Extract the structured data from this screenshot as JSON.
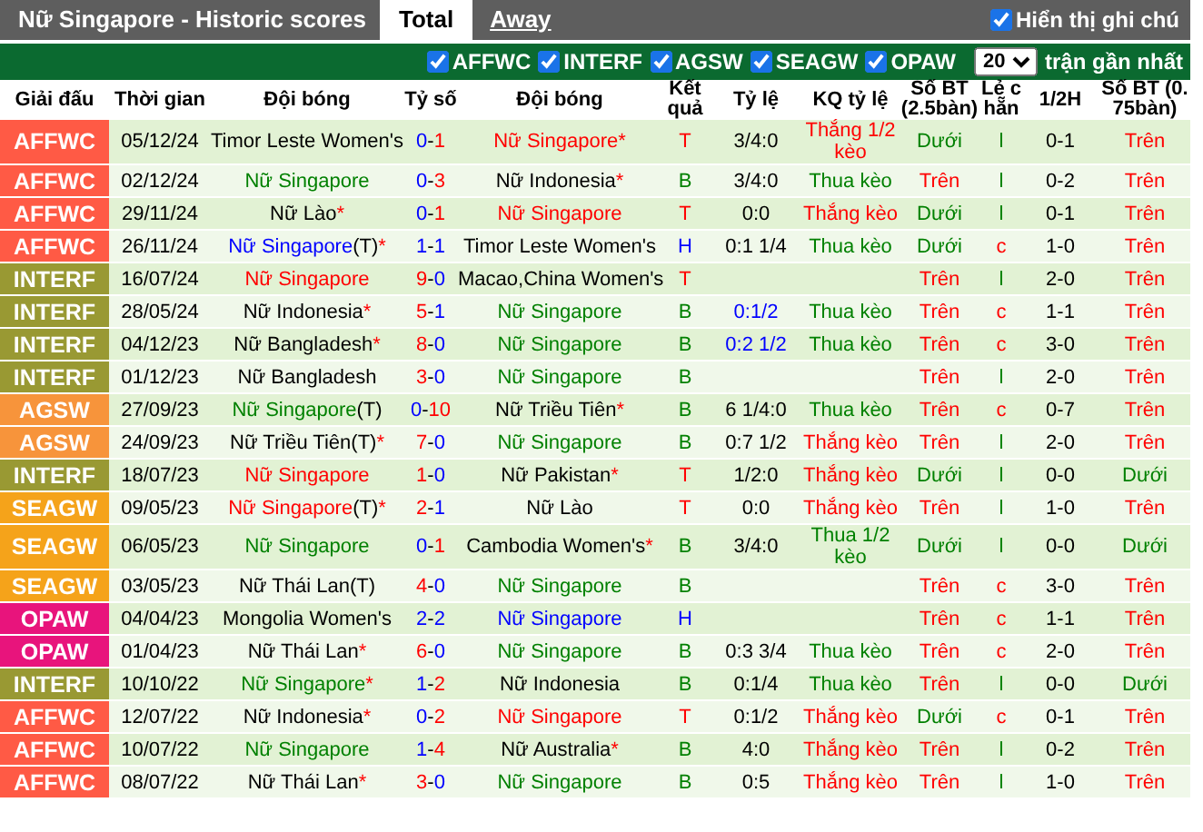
{
  "top_bar": {
    "title": "Nữ Singapore - Historic scores",
    "tabs": [
      {
        "label": "Total",
        "selected": true
      },
      {
        "label": "Away",
        "selected": false
      }
    ],
    "notes_toggle": {
      "label": "Hiển thị ghi chú",
      "checked": true
    }
  },
  "filter_bar": {
    "filters": [
      {
        "label": "AFFWC",
        "checked": true
      },
      {
        "label": "INTERF",
        "checked": true
      },
      {
        "label": "AGSW",
        "checked": true
      },
      {
        "label": "SEAGW",
        "checked": true
      },
      {
        "label": "OPAW",
        "checked": true
      }
    ],
    "count": "20",
    "count_label": "trận gần nhất"
  },
  "columns": [
    "Giải đấu",
    "Thời gian",
    "Đội bóng",
    "Tỷ số",
    "Đội bóng",
    "Kết quả",
    "Tỷ lệ",
    "KQ tỷ lệ",
    "Số BT (2.5bàn)",
    "Lẻ chẵn",
    "1/2H",
    "Số BT (0.75bàn)"
  ],
  "rows": [
    {
      "league": {
        "text": "AFFWC",
        "color": "#ff5a45"
      },
      "date": "05/12/24",
      "home": {
        "name": "Timor Leste Women's",
        "color": "#000000"
      },
      "score": {
        "home": {
          "text": "0",
          "color": "#0000ff"
        },
        "separator": "-",
        "away": {
          "text": "1",
          "color": "#ff0000"
        }
      },
      "away": {
        "name": "Nữ Singapore",
        "color": "#ff0000",
        "note": "*"
      },
      "result": {
        "text": "T",
        "color": "#ff0000"
      },
      "odds": {
        "text": "3/4:0",
        "color": "#000000"
      },
      "odds_result": {
        "text": "Thắng 1/2 kèo",
        "color": "#ff0000"
      },
      "goals_2_5": {
        "text": "Dưới",
        "color": "#008000"
      },
      "odd_even": {
        "text": "l",
        "color": "#008000"
      },
      "half_time": "0-1",
      "goals_0_75": {
        "text": "Trên",
        "color": "#ff0000"
      }
    },
    {
      "league": {
        "text": "AFFWC",
        "color": "#ff5a45"
      },
      "date": "02/12/24",
      "home": {
        "name": "Nữ Singapore",
        "color": "#008000"
      },
      "score": {
        "home": {
          "text": "0",
          "color": "#0000ff"
        },
        "separator": "-",
        "away": {
          "text": "3",
          "color": "#ff0000"
        }
      },
      "away": {
        "name": "Nữ Indonesia",
        "color": "#000000",
        "note": "*"
      },
      "result": {
        "text": "B",
        "color": "#008000"
      },
      "odds": {
        "text": "3/4:0",
        "color": "#000000"
      },
      "odds_result": {
        "text": "Thua kèo",
        "color": "#008000"
      },
      "goals_2_5": {
        "text": "Trên",
        "color": "#ff0000"
      },
      "odd_even": {
        "text": "l",
        "color": "#008000"
      },
      "half_time": "0-2",
      "goals_0_75": {
        "text": "Trên",
        "color": "#ff0000"
      }
    },
    {
      "league": {
        "text": "AFFWC",
        "color": "#ff5a45"
      },
      "date": "29/11/24",
      "home": {
        "name": "Nữ Lào",
        "color": "#000000",
        "note": "*"
      },
      "score": {
        "home": {
          "text": "0",
          "color": "#0000ff"
        },
        "separator": "-",
        "away": {
          "text": "1",
          "color": "#ff0000"
        }
      },
      "away": {
        "name": "Nữ Singapore",
        "color": "#ff0000"
      },
      "result": {
        "text": "T",
        "color": "#ff0000"
      },
      "odds": {
        "text": "0:0",
        "color": "#000000"
      },
      "odds_result": {
        "text": "Thắng kèo",
        "color": "#ff0000"
      },
      "goals_2_5": {
        "text": "Dưới",
        "color": "#008000"
      },
      "odd_even": {
        "text": "l",
        "color": "#008000"
      },
      "half_time": "0-1",
      "goals_0_75": {
        "text": "Trên",
        "color": "#ff0000"
      }
    },
    {
      "league": {
        "text": "AFFWC",
        "color": "#ff5a45"
      },
      "date": "26/11/24",
      "home": {
        "name": "Nữ Singapore",
        "color": "#0000ff",
        "suffix": "(T)",
        "note": "*"
      },
      "score": {
        "home": {
          "text": "1",
          "color": "#0000ff"
        },
        "separator": "-",
        "away": {
          "text": "1",
          "color": "#0000ff"
        }
      },
      "away": {
        "name": "Timor Leste Women's",
        "color": "#000000"
      },
      "result": {
        "text": "H",
        "color": "#0000ff"
      },
      "odds": {
        "text": "0:1 1/4",
        "color": "#000000"
      },
      "odds_result": {
        "text": "Thua kèo",
        "color": "#008000"
      },
      "goals_2_5": {
        "text": "Dưới",
        "color": "#008000"
      },
      "odd_even": {
        "text": "c",
        "color": "#ff0000"
      },
      "half_time": "1-0",
      "goals_0_75": {
        "text": "Trên",
        "color": "#ff0000"
      }
    },
    {
      "league": {
        "text": "INTERF",
        "color": "#999933"
      },
      "date": "16/07/24",
      "home": {
        "name": "Nữ Singapore",
        "color": "#ff0000"
      },
      "score": {
        "home": {
          "text": "9",
          "color": "#ff0000"
        },
        "separator": "-",
        "away": {
          "text": "0",
          "color": "#0000ff"
        }
      },
      "away": {
        "name": "Macao,China Women's",
        "color": "#000000"
      },
      "result": {
        "text": "T",
        "color": "#ff0000"
      },
      "goals_2_5": {
        "text": "Trên",
        "color": "#ff0000"
      },
      "odd_even": {
        "text": "l",
        "color": "#008000"
      },
      "half_time": "2-0",
      "goals_0_75": {
        "text": "Trên",
        "color": "#ff0000"
      }
    },
    {
      "league": {
        "text": "INTERF",
        "color": "#999933"
      },
      "date": "28/05/24",
      "home": {
        "name": "Nữ Indonesia",
        "color": "#000000",
        "note": "*"
      },
      "score": {
        "home": {
          "text": "5",
          "color": "#ff0000"
        },
        "separator": "-",
        "away": {
          "text": "1",
          "color": "#0000ff"
        }
      },
      "away": {
        "name": "Nữ Singapore",
        "color": "#008000"
      },
      "result": {
        "text": "B",
        "color": "#008000"
      },
      "odds": {
        "text": "0:1/2",
        "color": "#0000ff"
      },
      "odds_result": {
        "text": "Thua kèo",
        "color": "#008000"
      },
      "goals_2_5": {
        "text": "Trên",
        "color": "#ff0000"
      },
      "odd_even": {
        "text": "c",
        "color": "#ff0000"
      },
      "half_time": "1-1",
      "goals_0_75": {
        "text": "Trên",
        "color": "#ff0000"
      }
    },
    {
      "league": {
        "text": "INTERF",
        "color": "#999933"
      },
      "date": "04/12/23",
      "home": {
        "name": "Nữ Bangladesh",
        "color": "#000000",
        "note": "*"
      },
      "score": {
        "home": {
          "text": "8",
          "color": "#ff0000"
        },
        "separator": "-",
        "away": {
          "text": "0",
          "color": "#0000ff"
        }
      },
      "away": {
        "name": "Nữ Singapore",
        "color": "#008000"
      },
      "result": {
        "text": "B",
        "color": "#008000"
      },
      "odds": {
        "text": "0:2 1/2",
        "color": "#0000ff"
      },
      "odds_result": {
        "text": "Thua kèo",
        "color": "#008000"
      },
      "goals_2_5": {
        "text": "Trên",
        "color": "#ff0000"
      },
      "odd_even": {
        "text": "c",
        "color": "#ff0000"
      },
      "half_time": "3-0",
      "goals_0_75": {
        "text": "Trên",
        "color": "#ff0000"
      }
    },
    {
      "league": {
        "text": "INTERF",
        "color": "#999933"
      },
      "date": "01/12/23",
      "home": {
        "name": "Nữ Bangladesh",
        "color": "#000000"
      },
      "score": {
        "home": {
          "text": "3",
          "color": "#ff0000"
        },
        "separator": "-",
        "away": {
          "text": "0",
          "color": "#0000ff"
        }
      },
      "away": {
        "name": "Nữ Singapore",
        "color": "#008000"
      },
      "result": {
        "text": "B",
        "color": "#008000"
      },
      "goals_2_5": {
        "text": "Trên",
        "color": "#ff0000"
      },
      "odd_even": {
        "text": "l",
        "color": "#008000"
      },
      "half_time": "2-0",
      "goals_0_75": {
        "text": "Trên",
        "color": "#ff0000"
      }
    },
    {
      "league": {
        "text": "AGSW",
        "color": "#f7943b"
      },
      "date": "27/09/23",
      "home": {
        "name": "Nữ Singapore",
        "color": "#008000",
        "suffix": "(T)"
      },
      "score": {
        "home": {
          "text": "0",
          "color": "#0000ff"
        },
        "separator": "-",
        "away": {
          "text": "10",
          "color": "#ff0000"
        }
      },
      "away": {
        "name": "Nữ Triều Tiên",
        "color": "#000000",
        "note": "*"
      },
      "result": {
        "text": "B",
        "color": "#008000"
      },
      "odds": {
        "text": "6 1/4:0",
        "color": "#000000"
      },
      "odds_result": {
        "text": "Thua kèo",
        "color": "#008000"
      },
      "goals_2_5": {
        "text": "Trên",
        "color": "#ff0000"
      },
      "odd_even": {
        "text": "c",
        "color": "#ff0000"
      },
      "half_time": "0-7",
      "goals_0_75": {
        "text": "Trên",
        "color": "#ff0000"
      }
    },
    {
      "league": {
        "text": "AGSW",
        "color": "#f7943b"
      },
      "date": "24/09/23",
      "home": {
        "name": "Nữ Triều Tiên",
        "color": "#000000",
        "suffix": "(T)",
        "note": "*"
      },
      "score": {
        "home": {
          "text": "7",
          "color": "#ff0000"
        },
        "separator": "-",
        "away": {
          "text": "0",
          "color": "#0000ff"
        }
      },
      "away": {
        "name": "Nữ Singapore",
        "color": "#008000"
      },
      "result": {
        "text": "B",
        "color": "#008000"
      },
      "odds": {
        "text": "0:7 1/2",
        "color": "#000000"
      },
      "odds_result": {
        "text": "Thắng kèo",
        "color": "#ff0000"
      },
      "goals_2_5": {
        "text": "Trên",
        "color": "#ff0000"
      },
      "odd_even": {
        "text": "l",
        "color": "#008000"
      },
      "half_time": "2-0",
      "goals_0_75": {
        "text": "Trên",
        "color": "#ff0000"
      }
    },
    {
      "league": {
        "text": "INTERF",
        "color": "#999933"
      },
      "date": "18/07/23",
      "home": {
        "name": "Nữ Singapore",
        "color": "#ff0000"
      },
      "score": {
        "home": {
          "text": "1",
          "color": "#ff0000"
        },
        "separator": "-",
        "away": {
          "text": "0",
          "color": "#0000ff"
        }
      },
      "away": {
        "name": "Nữ Pakistan",
        "color": "#000000",
        "note": "*"
      },
      "result": {
        "text": "T",
        "color": "#ff0000"
      },
      "odds": {
        "text": "1/2:0",
        "color": "#000000"
      },
      "odds_result": {
        "text": "Thắng kèo",
        "color": "#ff0000"
      },
      "goals_2_5": {
        "text": "Dưới",
        "color": "#008000"
      },
      "odd_even": {
        "text": "l",
        "color": "#008000"
      },
      "half_time": "0-0",
      "goals_0_75": {
        "text": "Dưới",
        "color": "#008000"
      }
    },
    {
      "league": {
        "text": "SEAGW",
        "color": "#f5a31a"
      },
      "date": "09/05/23",
      "home": {
        "name": "Nữ Singapore",
        "color": "#ff0000",
        "suffix": "(T)",
        "note": "*"
      },
      "score": {
        "home": {
          "text": "2",
          "color": "#ff0000"
        },
        "separator": "-",
        "away": {
          "text": "1",
          "color": "#0000ff"
        }
      },
      "away": {
        "name": "Nữ Lào",
        "color": "#000000"
      },
      "result": {
        "text": "T",
        "color": "#ff0000"
      },
      "odds": {
        "text": "0:0",
        "color": "#000000"
      },
      "odds_result": {
        "text": "Thắng kèo",
        "color": "#ff0000"
      },
      "goals_2_5": {
        "text": "Trên",
        "color": "#ff0000"
      },
      "odd_even": {
        "text": "l",
        "color": "#008000"
      },
      "half_time": "1-0",
      "goals_0_75": {
        "text": "Trên",
        "color": "#ff0000"
      }
    },
    {
      "league": {
        "text": "SEAGW",
        "color": "#f5a31a"
      },
      "date": "06/05/23",
      "home": {
        "name": "Nữ Singapore",
        "color": "#008000"
      },
      "score": {
        "home": {
          "text": "0",
          "color": "#0000ff"
        },
        "separator": "-",
        "away": {
          "text": "1",
          "color": "#ff0000"
        }
      },
      "away": {
        "name": "Cambodia Women's",
        "color": "#000000",
        "note": "*"
      },
      "result": {
        "text": "B",
        "color": "#008000"
      },
      "odds": {
        "text": "3/4:0",
        "color": "#000000"
      },
      "odds_result": {
        "text": "Thua 1/2 kèo",
        "color": "#008000"
      },
      "goals_2_5": {
        "text": "Dưới",
        "color": "#008000"
      },
      "odd_even": {
        "text": "l",
        "color": "#008000"
      },
      "half_time": "0-0",
      "goals_0_75": {
        "text": "Dưới",
        "color": "#008000"
      }
    },
    {
      "league": {
        "text": "SEAGW",
        "color": "#f5a31a"
      },
      "date": "03/05/23",
      "home": {
        "name": "Nữ Thái Lan",
        "color": "#000000",
        "suffix": "(T)"
      },
      "score": {
        "home": {
          "text": "4",
          "color": "#ff0000"
        },
        "separator": "-",
        "away": {
          "text": "0",
          "color": "#0000ff"
        }
      },
      "away": {
        "name": "Nữ Singapore",
        "color": "#008000"
      },
      "result": {
        "text": "B",
        "color": "#008000"
      },
      "goals_2_5": {
        "text": "Trên",
        "color": "#ff0000"
      },
      "odd_even": {
        "text": "c",
        "color": "#ff0000"
      },
      "half_time": "3-0",
      "goals_0_75": {
        "text": "Trên",
        "color": "#ff0000"
      }
    },
    {
      "league": {
        "text": "OPAW",
        "color": "#e8147c"
      },
      "date": "04/04/23",
      "home": {
        "name": "Mongolia Women's",
        "color": "#000000"
      },
      "score": {
        "home": {
          "text": "2",
          "color": "#0000ff"
        },
        "separator": "-",
        "away": {
          "text": "2",
          "color": "#0000ff"
        }
      },
      "away": {
        "name": "Nữ Singapore",
        "color": "#0000ff"
      },
      "result": {
        "text": "H",
        "color": "#0000ff"
      },
      "goals_2_5": {
        "text": "Trên",
        "color": "#ff0000"
      },
      "odd_even": {
        "text": "c",
        "color": "#ff0000"
      },
      "half_time": "1-1",
      "goals_0_75": {
        "text": "Trên",
        "color": "#ff0000"
      }
    },
    {
      "league": {
        "text": "OPAW",
        "color": "#e8147c"
      },
      "date": "01/04/23",
      "home": {
        "name": "Nữ Thái Lan",
        "color": "#000000",
        "note": "*"
      },
      "score": {
        "home": {
          "text": "6",
          "color": "#ff0000"
        },
        "separator": "-",
        "away": {
          "text": "0",
          "color": "#0000ff"
        }
      },
      "away": {
        "name": "Nữ Singapore",
        "color": "#008000"
      },
      "result": {
        "text": "B",
        "color": "#008000"
      },
      "odds": {
        "text": "0:3 3/4",
        "color": "#000000"
      },
      "odds_result": {
        "text": "Thua kèo",
        "color": "#008000"
      },
      "goals_2_5": {
        "text": "Trên",
        "color": "#ff0000"
      },
      "odd_even": {
        "text": "c",
        "color": "#ff0000"
      },
      "half_time": "2-0",
      "goals_0_75": {
        "text": "Trên",
        "color": "#ff0000"
      }
    },
    {
      "league": {
        "text": "INTERF",
        "color": "#999933"
      },
      "date": "10/10/22",
      "home": {
        "name": "Nữ Singapore",
        "color": "#008000",
        "note": "*"
      },
      "score": {
        "home": {
          "text": "1",
          "color": "#0000ff"
        },
        "separator": "-",
        "away": {
          "text": "2",
          "color": "#ff0000"
        }
      },
      "away": {
        "name": "Nữ Indonesia",
        "color": "#000000"
      },
      "result": {
        "text": "B",
        "color": "#008000"
      },
      "odds": {
        "text": "0:1/4",
        "color": "#000000"
      },
      "odds_result": {
        "text": "Thua kèo",
        "color": "#008000"
      },
      "goals_2_5": {
        "text": "Trên",
        "color": "#ff0000"
      },
      "odd_even": {
        "text": "l",
        "color": "#008000"
      },
      "half_time": "0-0",
      "goals_0_75": {
        "text": "Dưới",
        "color": "#008000"
      }
    },
    {
      "league": {
        "text": "AFFWC",
        "color": "#ff5a45"
      },
      "date": "12/07/22",
      "home": {
        "name": "Nữ Indonesia",
        "color": "#000000",
        "note": "*"
      },
      "score": {
        "home": {
          "text": "0",
          "color": "#0000ff"
        },
        "separator": "-",
        "away": {
          "text": "2",
          "color": "#ff0000"
        }
      },
      "away": {
        "name": "Nữ Singapore",
        "color": "#ff0000"
      },
      "result": {
        "text": "T",
        "color": "#ff0000"
      },
      "odds": {
        "text": "0:1/2",
        "color": "#000000"
      },
      "odds_result": {
        "text": "Thắng kèo",
        "color": "#ff0000"
      },
      "goals_2_5": {
        "text": "Dưới",
        "color": "#008000"
      },
      "odd_even": {
        "text": "c",
        "color": "#ff0000"
      },
      "half_time": "0-1",
      "goals_0_75": {
        "text": "Trên",
        "color": "#ff0000"
      }
    },
    {
      "league": {
        "text": "AFFWC",
        "color": "#ff5a45"
      },
      "date": "10/07/22",
      "home": {
        "name": "Nữ Singapore",
        "color": "#008000"
      },
      "score": {
        "home": {
          "text": "1",
          "color": "#0000ff"
        },
        "separator": "-",
        "away": {
          "text": "4",
          "color": "#ff0000"
        }
      },
      "away": {
        "name": "Nữ Australia",
        "color": "#000000",
        "note": "*"
      },
      "result": {
        "text": "B",
        "color": "#008000"
      },
      "odds": {
        "text": "4:0",
        "color": "#000000"
      },
      "odds_result": {
        "text": "Thắng kèo",
        "color": "#ff0000"
      },
      "goals_2_5": {
        "text": "Trên",
        "color": "#ff0000"
      },
      "odd_even": {
        "text": "l",
        "color": "#008000"
      },
      "half_time": "0-2",
      "goals_0_75": {
        "text": "Trên",
        "color": "#ff0000"
      }
    },
    {
      "league": {
        "text": "AFFWC",
        "color": "#ff5a45"
      },
      "date": "08/07/22",
      "home": {
        "name": "Nữ Thái Lan",
        "color": "#000000",
        "note": "*"
      },
      "score": {
        "home": {
          "text": "3",
          "color": "#ff0000"
        },
        "separator": "-",
        "away": {
          "text": "0",
          "color": "#0000ff"
        }
      },
      "away": {
        "name": "Nữ Singapore",
        "color": "#008000"
      },
      "result": {
        "text": "B",
        "color": "#008000"
      },
      "odds": {
        "text": "0:5",
        "color": "#000000"
      },
      "odds_result": {
        "text": "Thắng kèo",
        "color": "#ff0000"
      },
      "goals_2_5": {
        "text": "Trên",
        "color": "#ff0000"
      },
      "odd_even": {
        "text": "l",
        "color": "#008000"
      },
      "half_time": "1-0",
      "goals_0_75": {
        "text": "Trên",
        "color": "#ff0000"
      }
    }
  ]
}
